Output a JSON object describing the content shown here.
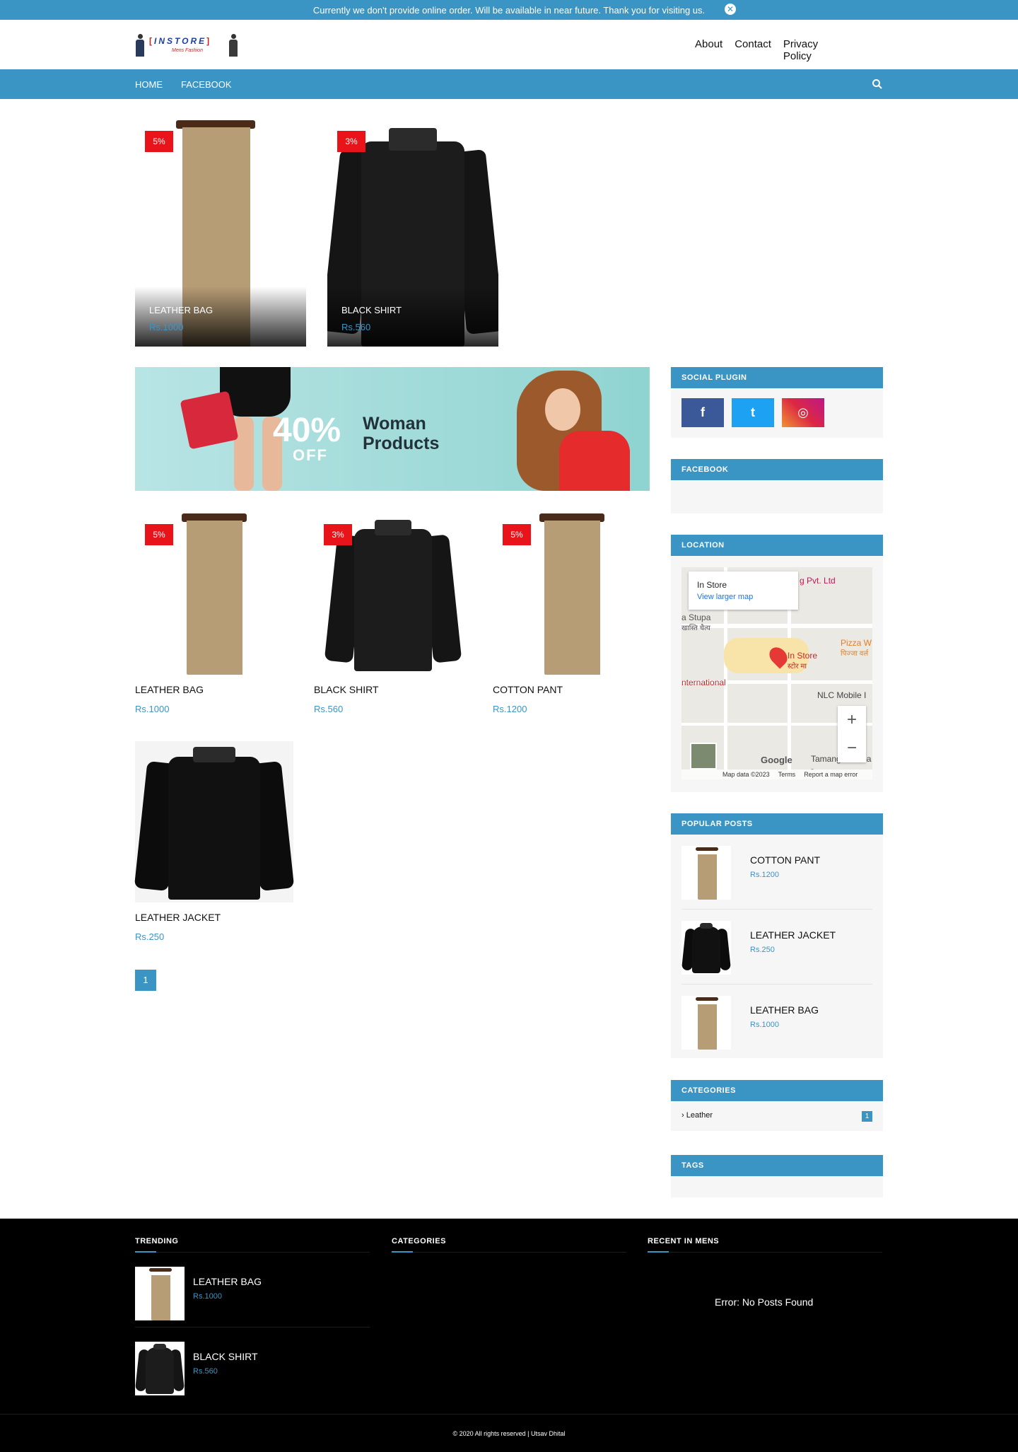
{
  "notice": {
    "text": "Currently we don't provide online order. Will be available in near future. Thank you for visiting us.",
    "close_icon": "close-icon",
    "close_symbol": "✕"
  },
  "header": {
    "logo": {
      "brand": "INSTORE",
      "bracket_left": "[",
      "bracket_right": "]",
      "tagline": "Mens Fashion"
    },
    "links": [
      "About",
      "Contact",
      "Privacy Policy"
    ]
  },
  "nav": {
    "items": [
      "HOME",
      "FACEBOOK"
    ],
    "search_icon": "search-icon"
  },
  "featured": [
    {
      "title": "LEATHER BAG",
      "price": "Rs.1000",
      "badge": "5%",
      "image": "pant"
    },
    {
      "title": "BLACK SHIRT",
      "price": "Rs.560",
      "badge": "3%",
      "image": "shirt"
    }
  ],
  "banner": {
    "percent": "40%",
    "off": "OFF",
    "line1": "Woman",
    "line2": "Products"
  },
  "products": [
    {
      "title": "LEATHER BAG",
      "price": "Rs.1000",
      "badge": "5%",
      "image": "pant"
    },
    {
      "title": "BLACK SHIRT",
      "price": "Rs.560",
      "badge": "3%",
      "image": "shirt"
    },
    {
      "title": "COTTON PANT",
      "price": "Rs.1200",
      "badge": "5%",
      "image": "pant"
    },
    {
      "title": "LEATHER JACKET",
      "price": "Rs.250",
      "badge": "",
      "image": "jacket"
    }
  ],
  "pagination": {
    "current": "1"
  },
  "sidebar": {
    "social": {
      "title": "SOCIAL PLUGIN",
      "buttons": [
        {
          "label": "f",
          "icon": "facebook-icon",
          "color": "#3b5998"
        },
        {
          "label": "t",
          "icon": "twitter-icon",
          "color": "#1da1f2"
        },
        {
          "label": "◎",
          "icon": "instagram-icon",
          "color": "#c13584"
        }
      ]
    },
    "facebook": {
      "title": "FACEBOOK"
    },
    "location": {
      "title": "LOCATION",
      "place_name": "In Store",
      "view_larger": "View larger map",
      "pin_label": "In Store",
      "pin_label_local": "स्टोर मा",
      "labels": [
        "g Pvt. Ltd",
        "a Stupa",
        "खास्ति चैत्य",
        "Pizza W",
        "पिज्जा वर्ल",
        "nternational",
        "NLC Mobile I",
        "Tamang Gumba -"
      ],
      "zoom_in": "+",
      "zoom_out": "−",
      "google": "Google",
      "attribution": [
        "Map data ©2023",
        "Terms",
        "Report a map error"
      ]
    },
    "popular": {
      "title": "POPULAR POSTS",
      "items": [
        {
          "title": "COTTON PANT",
          "price": "Rs.1200",
          "image": "pant"
        },
        {
          "title": "LEATHER JACKET",
          "price": "Rs.250",
          "image": "jacket"
        },
        {
          "title": "LEATHER BAG",
          "price": "Rs.1000",
          "image": "pant"
        }
      ]
    },
    "categories": {
      "title": "CATEGORIES",
      "items": [
        {
          "label": "Leather",
          "count": "1"
        }
      ]
    },
    "tags": {
      "title": "TAGS"
    }
  },
  "footer": {
    "trending": {
      "title": "TRENDING",
      "items": [
        {
          "title": "LEATHER BAG",
          "price": "Rs.1000",
          "image": "pant"
        },
        {
          "title": "BLACK SHIRT",
          "price": "Rs.560",
          "image": "shirt"
        }
      ]
    },
    "categories": {
      "title": "CATEGORIES"
    },
    "recent": {
      "title": "RECENT IN MENS",
      "message": "Error: No Posts Found"
    },
    "copyright": "© 2020 All rights reserved | Utsav Dhital"
  },
  "colors": {
    "accent": "#3a95c4",
    "badge": "#e8141a",
    "footer_bg": "#000000"
  }
}
